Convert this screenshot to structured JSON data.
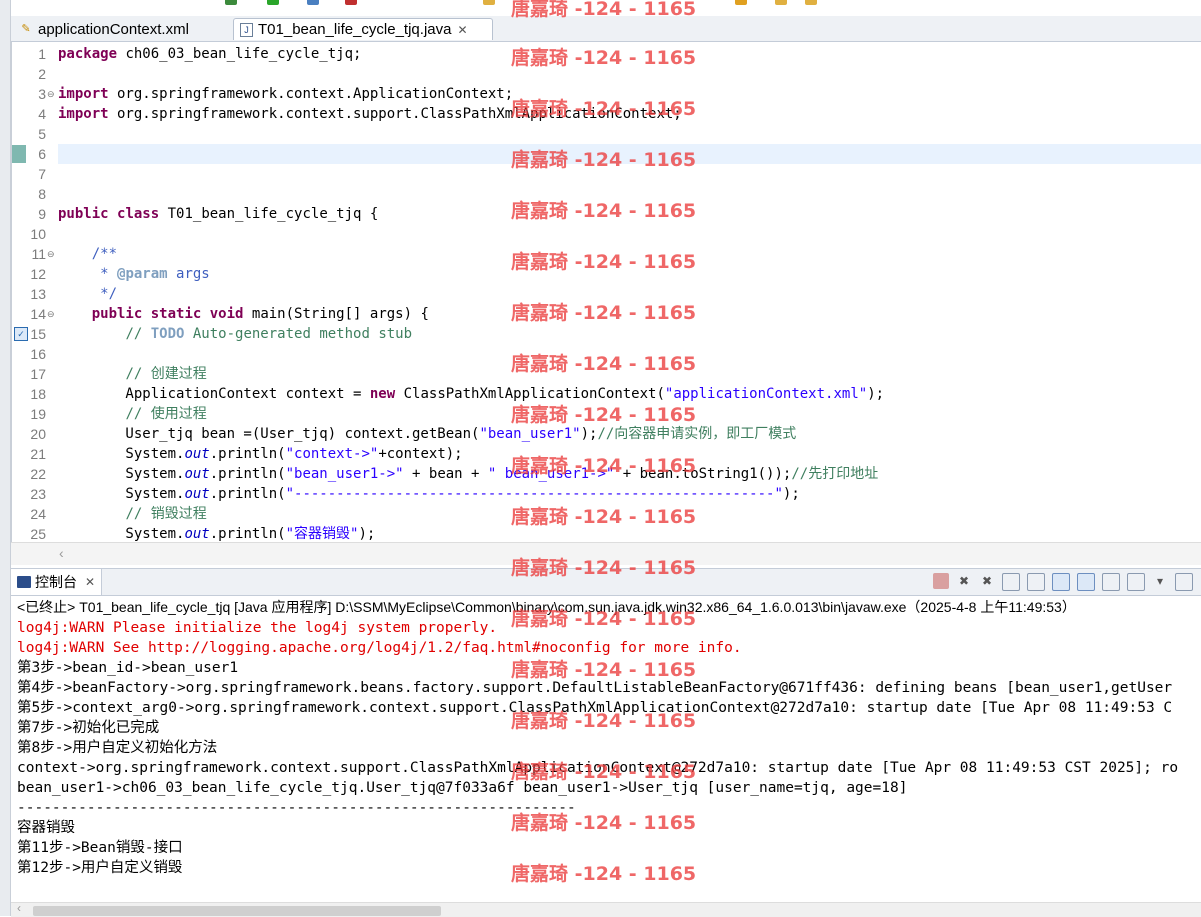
{
  "editor": {
    "tabs": [
      {
        "label": "applicationContext.xml",
        "icon": "xml-file-icon"
      },
      {
        "label": "T01_bean_life_cycle_tjq.java",
        "icon": "java-file-icon",
        "active": true
      }
    ],
    "line_numbers": [
      "1",
      "2",
      "3",
      "4",
      "5",
      "6",
      "7",
      "8",
      "9",
      "10",
      "11",
      "12",
      "13",
      "14",
      "15",
      "16",
      "17",
      "18",
      "19",
      "20",
      "21",
      "22",
      "23",
      "24",
      "25"
    ]
  },
  "console": {
    "title": "控制台",
    "status": "<已终止> T01_bean_life_cycle_tjq [Java 应用程序] D:\\SSM\\MyEclipse\\Common\\binary\\com.sun.java.jdk.win32.x86_64_1.6.0.013\\bin\\javaw.exe（2025-4-8 上午11:49:53）",
    "lines": [
      {
        "text": "log4j:WARN Please initialize the log4j system properly.",
        "error": true
      },
      {
        "text": "log4j:WARN See http://logging.apache.org/log4j/1.2/faq.html#noconfig for more info.",
        "error": true
      },
      {
        "text": "第3步->bean_id->bean_user1",
        "error": false
      },
      {
        "text": "第4步->beanFactory->org.springframework.beans.factory.support.DefaultListableBeanFactory@671ff436: defining beans [bean_user1,getUser",
        "error": false
      },
      {
        "text": "第5步->context_arg0->org.springframework.context.support.ClassPathXmlApplicationContext@272d7a10: startup date [Tue Apr 08 11:49:53 C",
        "error": false
      },
      {
        "text": "第7步->初始化已完成",
        "error": false
      },
      {
        "text": "第8步->用户自定义初始化方法",
        "error": false
      },
      {
        "text": "context->org.springframework.context.support.ClassPathXmlApplicationContext@272d7a10: startup date [Tue Apr 08 11:49:53 CST 2025]; ro",
        "error": false
      },
      {
        "text": "bean_user1->ch06_03_bean_life_cycle_tjq.User_tjq@7f033a6f bean_user1->User_tjq [user_name=tjq, age=18]",
        "error": false
      },
      {
        "text": "----------------------------------------------------------------",
        "error": false
      },
      {
        "text": "容器销毁",
        "error": false
      },
      {
        "text": "第11步->Bean销毁-接口",
        "error": false
      },
      {
        "text": "第12步->用户自定义销毁",
        "error": false
      }
    ]
  },
  "watermark": "唐嘉琦 -124 - 1165"
}
